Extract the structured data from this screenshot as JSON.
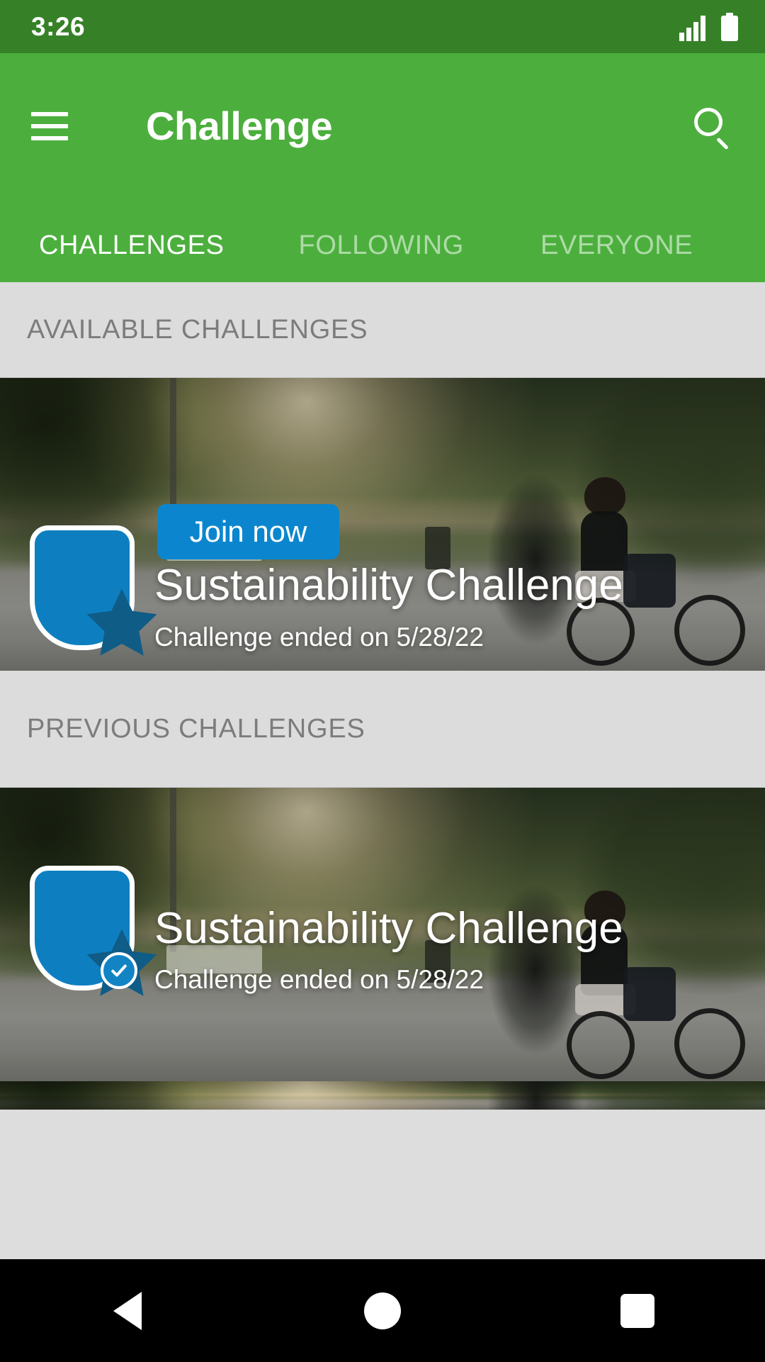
{
  "status_bar": {
    "time": "3:26",
    "signal_icon": "signal-bars-icon",
    "battery_icon": "battery-full-icon"
  },
  "app_bar": {
    "menu_icon": "hamburger-menu-icon",
    "title": "Challenge",
    "search_icon": "search-icon",
    "background_color": "#4caf3d",
    "tabs": [
      {
        "label": "CHALLENGES",
        "active": true
      },
      {
        "label": "FOLLOWING",
        "active": false
      },
      {
        "label": "EVERYONE",
        "active": false
      }
    ]
  },
  "sections": [
    {
      "header": "AVAILABLE CHALLENGES",
      "cards": [
        {
          "badge_icon": "shield-star-badge-icon",
          "completed": false,
          "join_label": "Join now",
          "title": "Sustainability Challenge",
          "subtitle": "Challenge ended on 5/28/22"
        }
      ]
    },
    {
      "header": "PREVIOUS CHALLENGES",
      "cards": [
        {
          "badge_icon": "shield-star-badge-icon",
          "completed": true,
          "check_icon": "check-circle-icon",
          "title": "Sustainability Challenge",
          "subtitle": "Challenge ended on 5/28/22"
        }
      ]
    }
  ],
  "colors": {
    "status_bar": "#368127",
    "app_bar": "#4caf3d",
    "section_bg": "#dcdcdc",
    "section_text": "#7c7c7c",
    "accent_blue": "#0b86ce",
    "shield_blue": "#0d7fc0",
    "star_blue": "#0f5c87",
    "nav_bar": "#000000"
  },
  "nav_bar": {
    "back_icon": "back-triangle-icon",
    "home_icon": "home-circle-icon",
    "recents_icon": "recents-square-icon"
  }
}
